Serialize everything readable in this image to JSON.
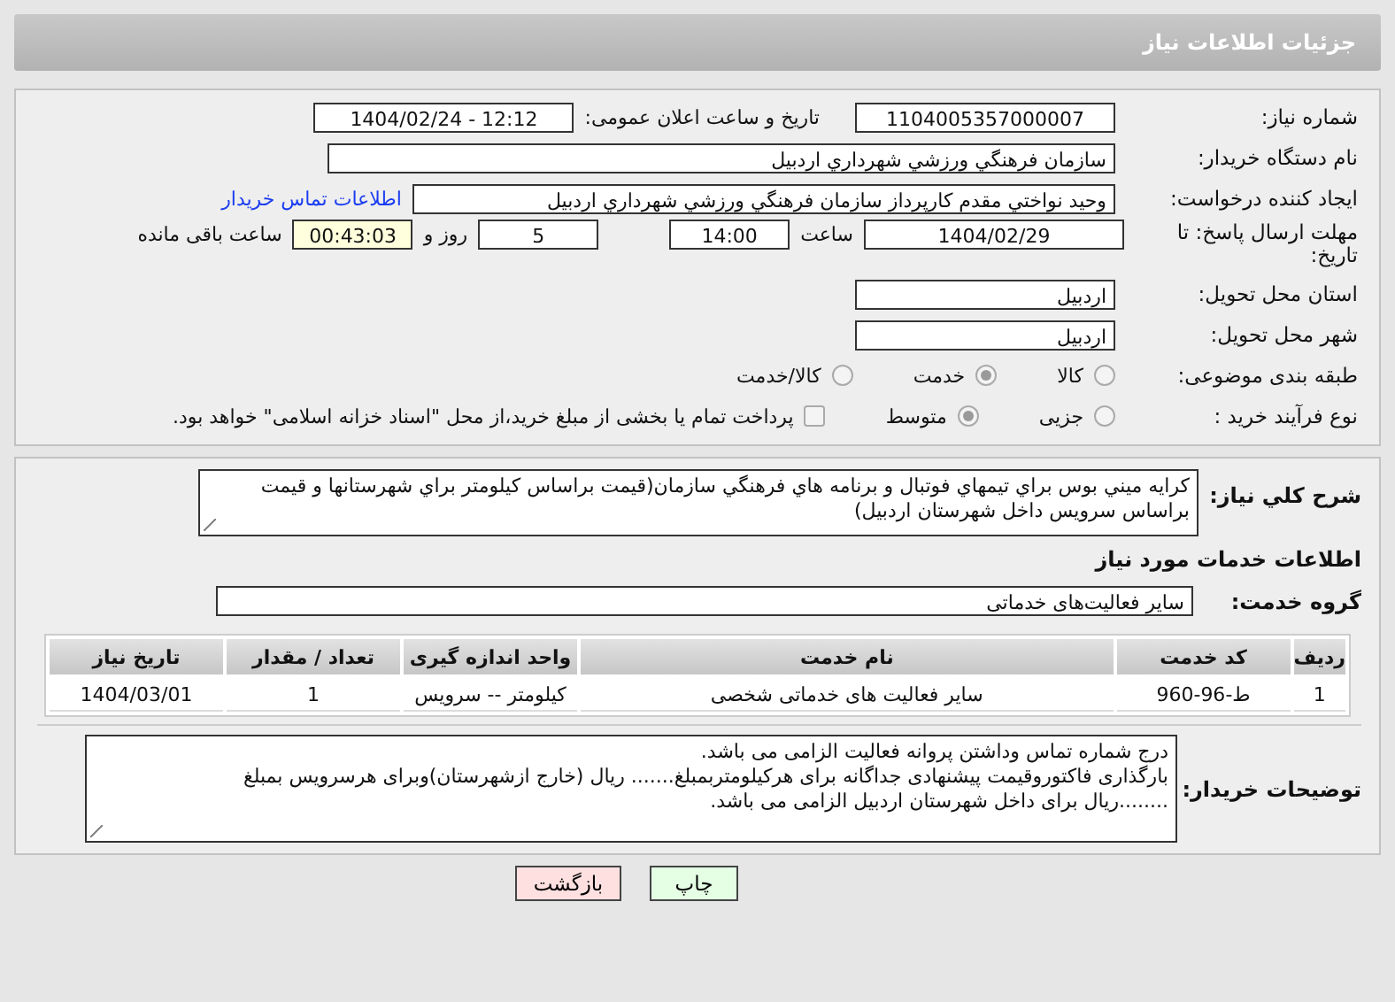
{
  "header": {
    "title": "جزئیات اطلاعات نیاز"
  },
  "need_info": {
    "need_number": {
      "label": "شماره نیاز:",
      "value": "1104005357000007"
    },
    "announce": {
      "label": "تاریخ و ساعت اعلان عمومی:",
      "value": "1404/02/24 - 12:12"
    },
    "buyer_org": {
      "label": "نام دستگاه خریدار:",
      "value": "سازمان فرهنگي ورزشي شهرداري اردبيل"
    },
    "requester": {
      "label": "ایجاد کننده درخواست:",
      "value": "وحيد نواختي مقدم كارپرداز سازمان فرهنگي ورزشي شهرداري اردبيل",
      "link": "اطلاعات تماس خریدار"
    },
    "deadline": {
      "label": "مهلت ارسال پاسخ: تا تاریخ:",
      "date": "1404/02/29",
      "time_label": "ساعت",
      "time": "14:00",
      "days": "5",
      "days_label": "روز و",
      "remaining": "00:43:03",
      "remaining_label": "ساعت باقی مانده"
    },
    "province": {
      "label": "استان محل تحویل:",
      "value": "اردبیل"
    },
    "city": {
      "label": "شهر محل تحویل:",
      "value": "اردبیل"
    },
    "category": {
      "label": "طبقه بندی موضوعی:",
      "options": [
        {
          "label": "کالا",
          "selected": false
        },
        {
          "label": "خدمت",
          "selected": true
        },
        {
          "label": "کالا/خدمت",
          "selected": false
        }
      ]
    },
    "process": {
      "label": "نوع فرآیند خرید :",
      "options": [
        {
          "label": "جزیی",
          "selected": false
        },
        {
          "label": "متوسط",
          "selected": true
        }
      ],
      "payment": {
        "label": "پرداخت تمام یا بخشی از مبلغ خرید،از محل \"اسناد خزانه اسلامی\" خواهد بود.",
        "checked": false
      }
    }
  },
  "details": {
    "description": {
      "label": "شرح كلي نياز:",
      "value": "كرايه ميني بوس براي تيمهاي فوتبال و برنامه هاي فرهنگي سازمان(قيمت براساس كيلومتر براي شهرستانها و قيمت براساس سرويس داخل شهرستان اردبيل)"
    },
    "services_heading": "اطلاعات خدمات مورد نیاز",
    "service_group": {
      "label": "گروه خدمت:",
      "value": "سایر فعالیت‌های خدماتی"
    },
    "table": {
      "columns": [
        "ردیف",
        "کد خدمت",
        "نام خدمت",
        "واحد اندازه گیری",
        "تعداد / مقدار",
        "تاریخ نیاز"
      ],
      "rows": [
        [
          "1",
          "ط-96-960",
          "سایر فعالیت های خدماتی شخصی",
          "کیلومتر -- سرویس",
          "1",
          "1404/03/01"
        ]
      ]
    },
    "buyer_notes": {
      "label": "توضیحات خریدار:",
      "lines": [
        "درج شماره تماس وداشتن پروانه فعالیت الزامی می باشد.",
        "بارگذاری فاکتوروقیمت پیشنهادی جداگانه برای هرکیلومتربمبلغ....... ریال (خارج ازشهرستان)وبرای هرسرویس بمبلغ",
        "........ریال برای داخل شهرستان اردبیل الزامی می باشد."
      ]
    }
  },
  "buttons": [
    {
      "label": "چاپ",
      "kind": "print"
    },
    {
      "label": "بازگشت",
      "kind": "back"
    }
  ]
}
